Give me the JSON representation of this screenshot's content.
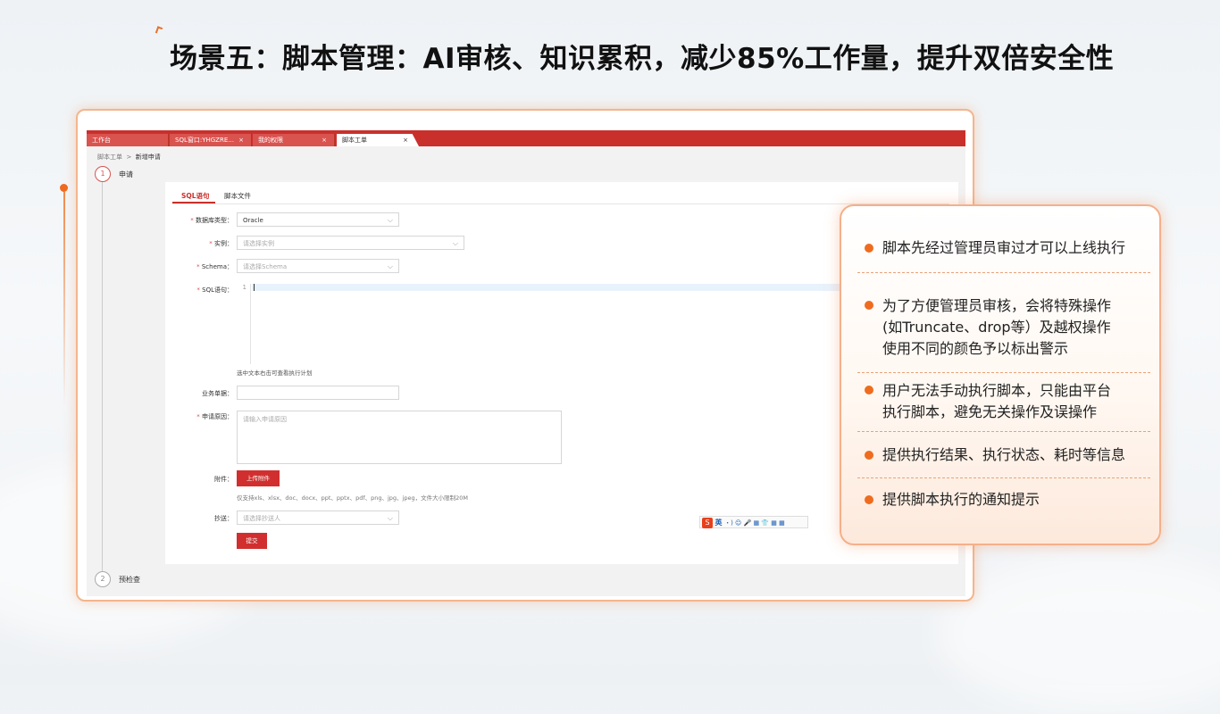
{
  "slide": {
    "title": "场景五：脚本管理：AI审核、知识累积，减少85%工作量，提升双倍安全性"
  },
  "app": {
    "tabs": [
      {
        "label": "工作台",
        "closable": false
      },
      {
        "label": "SQL窗口:YHGZRE...",
        "closable": true
      },
      {
        "label": "我的权限",
        "closable": true
      },
      {
        "label": "脚本工单",
        "closable": true,
        "active": true
      }
    ],
    "close_glyph": "×",
    "breadcrumb": {
      "parent": "脚本工单",
      "separator": ">",
      "current": "新增申请"
    },
    "steps": [
      {
        "number": "1",
        "label": "申请"
      },
      {
        "number": "2",
        "label": "预检查"
      }
    ],
    "form_tabs": [
      "SQL语句",
      "脚本文件"
    ],
    "fields": {
      "db_type": {
        "label": "数据库类型",
        "value": "Oracle"
      },
      "instance": {
        "label": "实例",
        "placeholder": "请选择实例"
      },
      "schema": {
        "label": "Schema",
        "placeholder": "请选择Schema"
      },
      "sql": {
        "label": "SQL语句",
        "line_number": "1"
      },
      "sql_hint": "选中文本右击可查看执行计划",
      "business_no": {
        "label": "业务单据",
        "value": ""
      },
      "reason": {
        "label": "申请原因",
        "placeholder": "请输入申请原因"
      },
      "attachment": {
        "label": "附件",
        "button": "上传附件",
        "hint": "仅支持xls、xlsx、doc、docx、ppt、pptx、pdf、png、jpg、jpeg，文件大小限制20M"
      },
      "cc": {
        "label": "抄送",
        "placeholder": "请选择抄送人"
      }
    },
    "submit_label": "提交",
    "ime": {
      "logo": "S",
      "mode": "英",
      "icons": "・) ☺ 🎤 ▦ 👕 ▦ ▦"
    }
  },
  "callout": {
    "items": [
      {
        "lines": [
          "脚本先经过管理员审过才可以上线执行"
        ]
      },
      {
        "lines": [
          "为了方便管理员审核，会将特殊操作",
          "(如Truncate、drop等）及越权操作",
          "使用不同的颜色予以标出警示"
        ]
      },
      {
        "lines": [
          "用户无法手动执行脚本，只能由平台",
          "执行脚本，避免无关操作及误操作"
        ]
      },
      {
        "lines": [
          "提供执行结果、执行状态、耗时等信息"
        ]
      },
      {
        "lines": [
          "提供脚本执行的通知提示"
        ]
      }
    ]
  },
  "colors": {
    "accent_orange": "#ef6c1e",
    "tab_red": "#c9302c",
    "button_red": "#d12f2f"
  }
}
